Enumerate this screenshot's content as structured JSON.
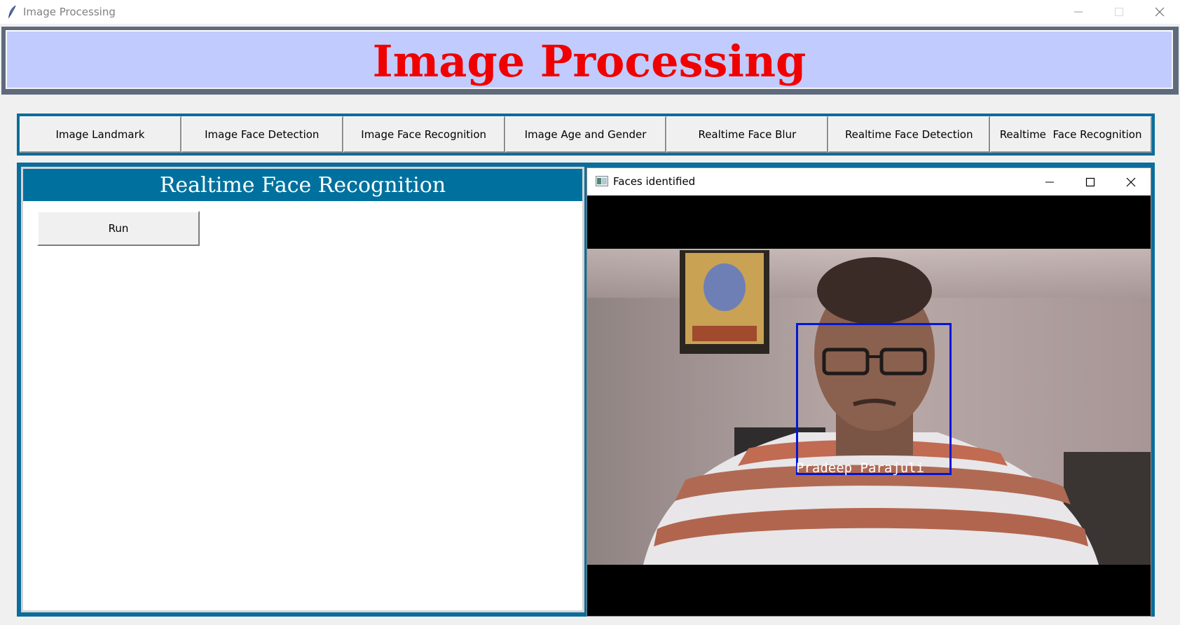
{
  "window": {
    "title": "Image Processing",
    "icon": "feather-icon",
    "controls": [
      "minimize-icon",
      "maximize-icon",
      "close-icon"
    ]
  },
  "banner": {
    "title": "Image Processing",
    "title_color": "#f00000",
    "background": "#c1cbfd"
  },
  "toolbar": {
    "buttons": [
      {
        "label": "Image Landmark"
      },
      {
        "label": "Image Face Detection"
      },
      {
        "label": "Image Face Recognition"
      },
      {
        "label": "Image Age and Gender"
      },
      {
        "label": "Realtime Face Blur"
      },
      {
        "label": "Realtime Face Detection"
      },
      {
        "label": "Realtime  Face Recognition"
      }
    ]
  },
  "panel": {
    "title": "Realtime Face Recognition",
    "header_color": "#00719e",
    "run_label": "Run"
  },
  "faces_window": {
    "title": "Faces identified",
    "icon": "opencv-window-icon",
    "controls": [
      "minimize-icon",
      "maximize-icon",
      "close-icon"
    ],
    "detection": {
      "name": "Pradeep  Parajuli",
      "box_color": "#0018d6"
    }
  }
}
